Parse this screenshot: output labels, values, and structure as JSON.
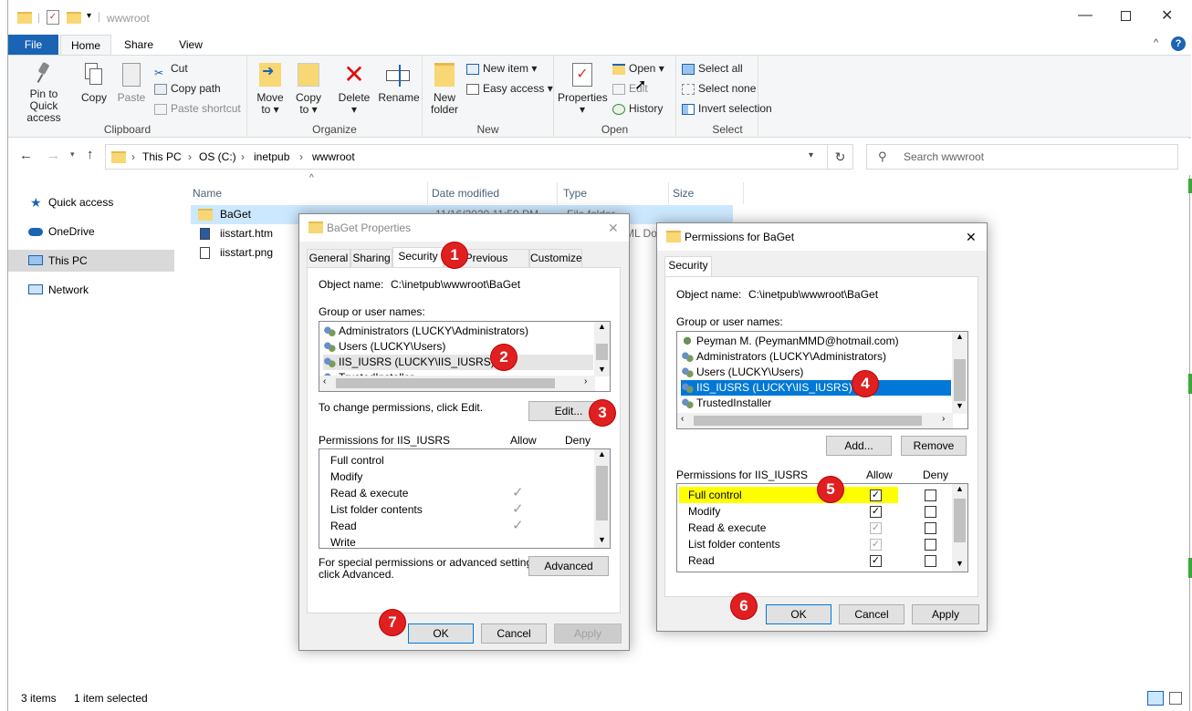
{
  "window": {
    "title": "wwwroot"
  },
  "ribbon_tabs": [
    "File",
    "Home",
    "Share",
    "View"
  ],
  "clipboard": {
    "pin": "Pin to Quick access",
    "copy": "Copy",
    "paste": "Paste",
    "cut": "Cut",
    "copy_path": "Copy path",
    "paste_shortcut": "Paste shortcut",
    "label": "Clipboard"
  },
  "organize": {
    "move": "Move",
    "copy": "Copy",
    "to": "to",
    "delete": "Delete",
    "rename": "Rename",
    "label": "Organize"
  },
  "newgrp": {
    "new_folder_1": "New",
    "new_folder_2": "folder",
    "new_item": "New item",
    "easy_access": "Easy access",
    "label": "New"
  },
  "opengrp": {
    "properties": "Properties",
    "open": "Open",
    "edit": "Edit",
    "history": "History",
    "label": "Open"
  },
  "selectgrp": {
    "select_all": "Select all",
    "select_none": "Select none",
    "invert": "Invert selection",
    "label": "Select"
  },
  "address": {
    "parts": [
      "This PC",
      "OS (C:)",
      "inetpub",
      "wwwroot"
    ],
    "search_placeholder": "Search wwwroot"
  },
  "nav": [
    "Quick access",
    "OneDrive",
    "This PC",
    "Network"
  ],
  "columns": [
    "Name",
    "Date modified",
    "Type",
    "Size"
  ],
  "files": [
    {
      "name": "BaGet",
      "date": "11/16/2020 11:50 PM",
      "type": "File folder"
    },
    {
      "name": "iisstart.htm",
      "date": "",
      "type": "HTML Doc..."
    },
    {
      "name": "iisstart.png",
      "date": "",
      "type": ""
    }
  ],
  "status": {
    "count": "3 items",
    "selected": "1 item selected"
  },
  "props": {
    "title": "BaGet Properties",
    "tabs": [
      "General",
      "Sharing",
      "Security",
      "Previous Versions",
      "Customize"
    ],
    "object_label": "Object name:",
    "object_value": "C:\\inetpub\\wwwroot\\BaGet",
    "group_label": "Group or user names:",
    "users": [
      "Administrators (LUCKY\\Administrators)",
      "Users (LUCKY\\Users)",
      "IIS_IUSRS (LUCKY\\IIS_IUSRS)",
      "TrustedInstaller"
    ],
    "change_text": "To change permissions, click Edit.",
    "edit_btn": "Edit...",
    "perm_label": "Permissions for IIS_IUSRS",
    "allow": "Allow",
    "deny": "Deny",
    "perms": [
      "Full control",
      "Modify",
      "Read & execute",
      "List folder contents",
      "Read",
      "Write"
    ],
    "special_1": "For special permissions or advanced settings,",
    "special_2": "click Advanced.",
    "advanced_btn": "Advanced",
    "ok": "OK",
    "cancel": "Cancel",
    "apply": "Apply"
  },
  "perm": {
    "title": "Permissions for BaGet",
    "tab": "Security",
    "object_label": "Object name:",
    "object_value": "C:\\inetpub\\wwwroot\\BaGet",
    "group_label": "Group or user names:",
    "users": [
      "Peyman M. (PeymanMMD@hotmail.com)",
      "Administrators (LUCKY\\Administrators)",
      "Users (LUCKY\\Users)",
      "IIS_IUSRS (LUCKY\\IIS_IUSRS)",
      "TrustedInstaller"
    ],
    "add_btn": "Add...",
    "remove_btn": "Remove",
    "perm_label": "Permissions for IIS_IUSRS",
    "allow": "Allow",
    "deny": "Deny",
    "perms": [
      "Full control",
      "Modify",
      "Read & execute",
      "List folder contents",
      "Read"
    ],
    "ok": "OK",
    "cancel": "Cancel",
    "apply": "Apply"
  },
  "badges": [
    "1",
    "2",
    "3",
    "4",
    "5",
    "6",
    "7"
  ],
  "colors": {
    "accent": "#0078d7",
    "highlight": "#ffff00",
    "badge": "#e02020"
  }
}
